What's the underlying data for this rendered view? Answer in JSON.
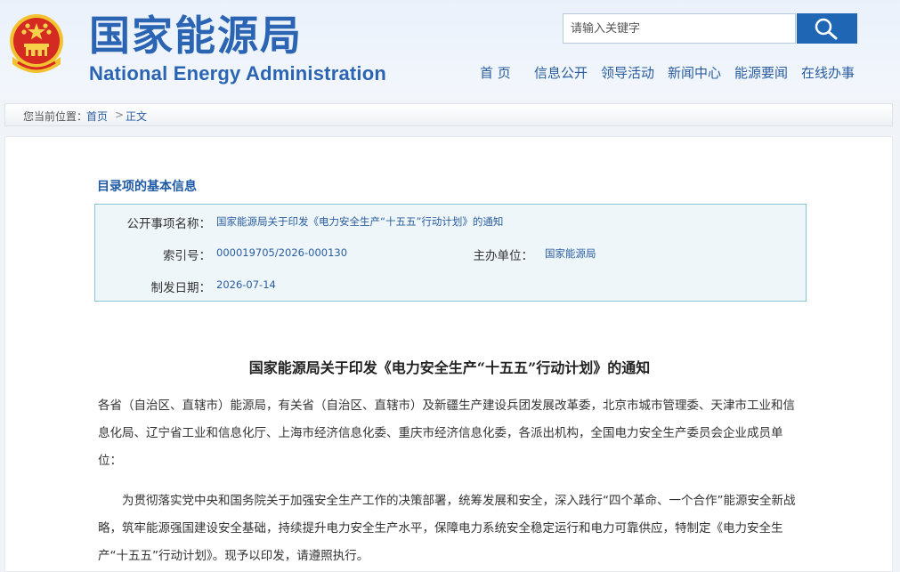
{
  "header": {
    "logo_cn": "国家能源局",
    "logo_en": "National Energy Administration",
    "search_placeholder": "请输入关键字"
  },
  "nav": {
    "items": [
      "首 页",
      "信息公开",
      "领导活动",
      "新闻中心",
      "能源要闻",
      "在线办事"
    ]
  },
  "breadcrumb": {
    "prefix": "您当前位置：",
    "home": "首页",
    "separator": ">",
    "current": "正文"
  },
  "info": {
    "section_title": "目录项的基本信息",
    "name_label": "公开事项名称：",
    "name_value": "国家能源局关于印发《电力安全生产“十五五”行动计划》的通知",
    "index_label": "索引号：",
    "index_value": "000019705/2026-000130",
    "org_label": "主办单位：",
    "org_value": "国家能源局",
    "date_label": "制发日期：",
    "date_value": "2026-07-14"
  },
  "document": {
    "title": "国家能源局关于印发《电力安全生产“十五五”行动计划》的通知",
    "recipients": "各省（自治区、直辖市）能源局，有关省（自治区、直辖市）及新疆生产建设兵团发展改革委，北京市城市管理委、天津市工业和信息化局、辽宁省工业和信息化厅、上海市经济信息化委、重庆市经济信息化委，各派出机构，全国电力安全生产委员会企业成员单位：",
    "body": "为贯彻落实党中央和国务院关于加强安全生产工作的决策部署，统筹发展和安全，深入践行“四个革命、一个合作”能源安全新战略，筑牢能源强国建设安全基础，持续提升电力安全生产水平，保障电力系统安全稳定运行和电力可靠供应，特制定《电力安全生产“十五五”行动计划》。现予以印发，请遵照执行。"
  },
  "colors": {
    "brand_blue": "#2a64b2",
    "search_button": "#1f66b4",
    "emblem_red": "#d42a22",
    "emblem_gold": "#f2c230"
  },
  "icons": {
    "emblem": "national-emblem",
    "search": "search-icon"
  }
}
